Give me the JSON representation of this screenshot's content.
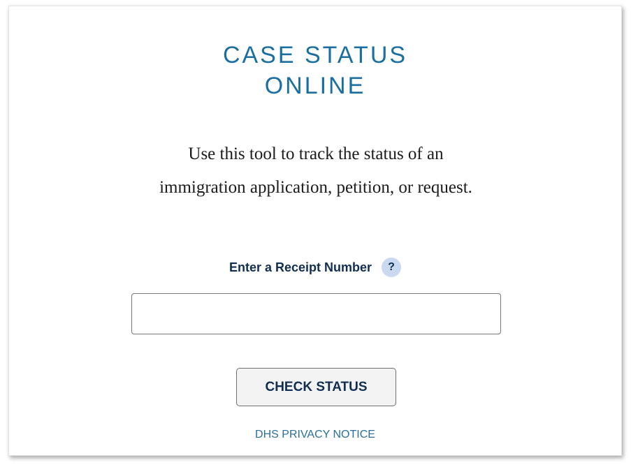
{
  "header": {
    "title_line1": "CASE STATUS",
    "title_line2": "ONLINE"
  },
  "intro": {
    "text": "Use this tool to track the status of an immigration application, petition, or request."
  },
  "receipt": {
    "label": "Enter a Receipt Number",
    "help_icon": "question-mark-icon",
    "help_glyph": "?",
    "input_value": "",
    "input_placeholder": ""
  },
  "actions": {
    "check_status_label": "CHECK STATUS",
    "privacy_link_label": "DHS PRIVACY NOTICE"
  },
  "colors": {
    "title": "#1b6fa0",
    "label": "#112e51",
    "help_bg": "#c9daf0",
    "link": "#2a6f9b",
    "button_bg": "#f3f3f3"
  }
}
